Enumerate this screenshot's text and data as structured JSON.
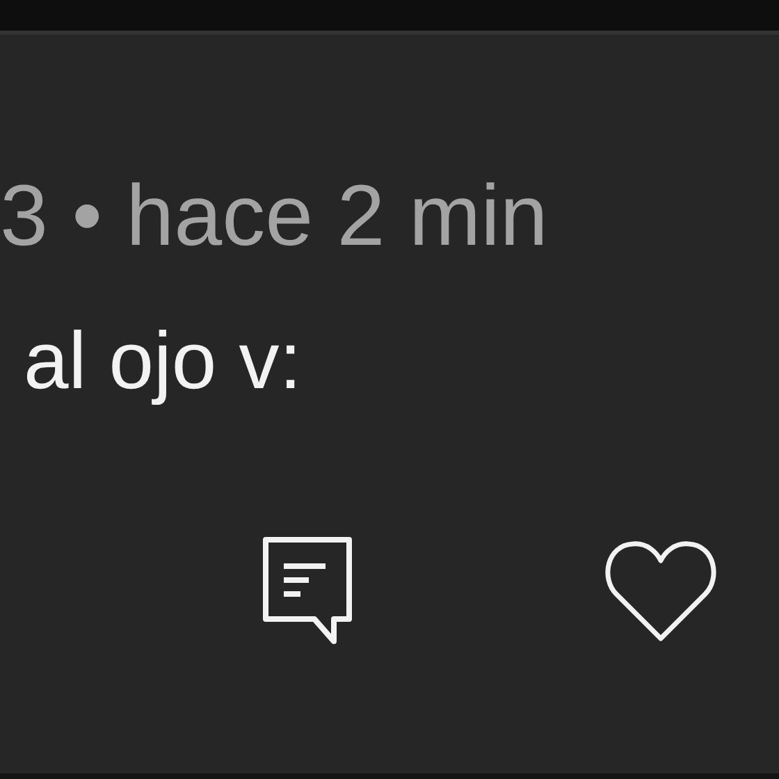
{
  "comment": {
    "meta": "3 • hace 2 min",
    "text": "al ojo v:"
  }
}
